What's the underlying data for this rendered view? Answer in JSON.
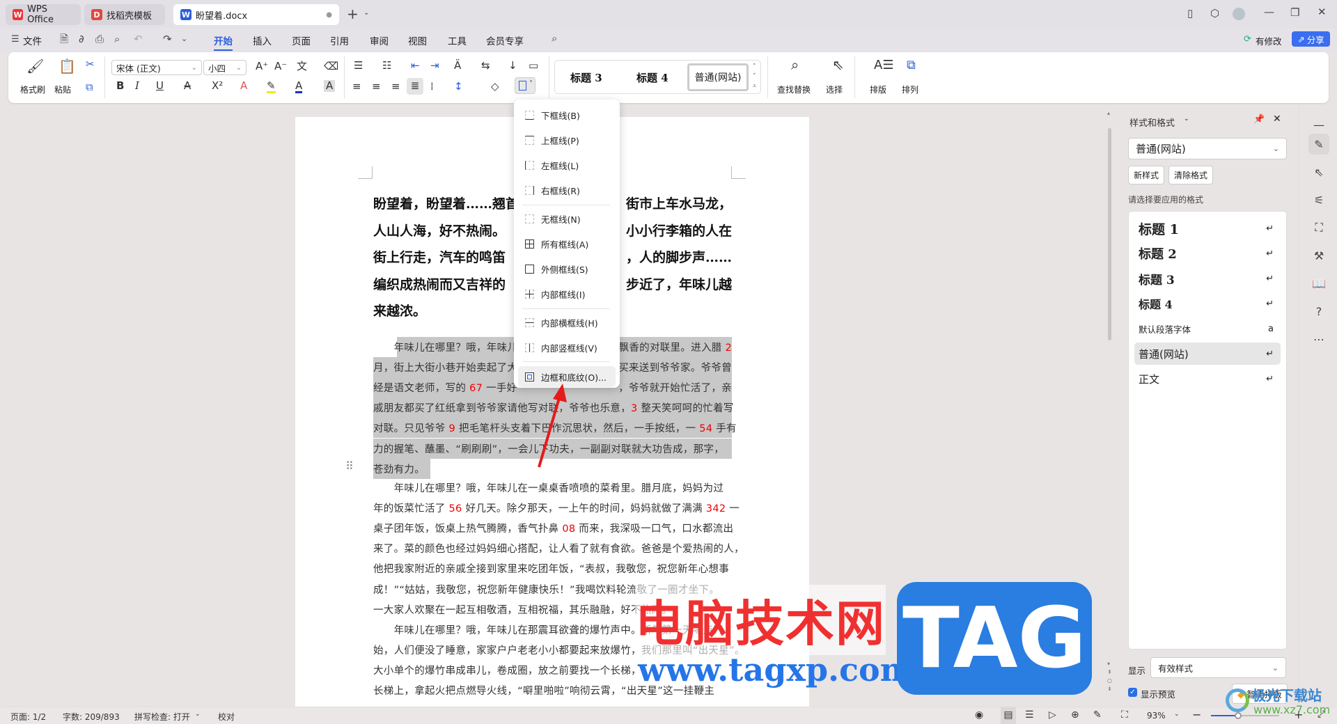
{
  "tabs": [
    {
      "label": "WPS Office",
      "icon": "wps-logo"
    },
    {
      "label": "找稻壳模板",
      "icon": "docer-logo"
    },
    {
      "label": "盼望着.docx",
      "icon": "word-doc-logo"
    }
  ],
  "menu": {
    "file": "文件",
    "tabs": [
      "开始",
      "插入",
      "页面",
      "引用",
      "审阅",
      "视图",
      "工具",
      "会员专享"
    ],
    "modified": "有修改",
    "share": "分享"
  },
  "ribbon": {
    "format_painter": "格式刷",
    "paste": "粘贴",
    "font_name": "宋体 (正文)",
    "font_size": "小四",
    "styles": [
      "标题 3",
      "标题 4",
      "普通(网站)"
    ],
    "find_replace": "查找替换",
    "select": "选择",
    "layout": "排版",
    "arrange": "排列"
  },
  "border_menu": {
    "items": [
      "下框线(B)",
      "上框线(P)",
      "左框线(L)",
      "右框线(R)",
      "无框线(N)",
      "所有框线(A)",
      "外侧框线(S)",
      "内部框线(I)",
      "内部横框线(H)",
      "内部竖框线(V)",
      "边框和底纹(O)..."
    ]
  },
  "document": {
    "heading_lines": [
      [
        "盼望着，盼望着……翘首",
        "。街市上车水马龙，"
      ],
      [
        "人山人海，好不热闹。",
        "小小行李箱的人在"
      ],
      [
        "街上行走，汽车的鸣笛",
        "，人的脚步声……"
      ],
      [
        "编织成热闹而又吉祥的",
        "步近了，年味儿越"
      ],
      [
        "来越浓。",
        ""
      ]
    ],
    "selected_lines": [
      [
        "　　年味儿在哪里？哦，年味儿",
        "飘香的对联里。进入腊 |2|"
      ],
      [
        "月，街上大街小巷开始卖起了大",
        "买来送到爷爷家。爷爷曾"
      ],
      [
        "经是语文老师，写的 |67| 一手好",
        "，爷爷就开始忙活了，亲"
      ],
      [
        "戚朋友都买了红纸拿到爷爷家请他写对联，爷爷也乐意，|3| 整天笑呵呵的忙着写",
        ""
      ],
      [
        "对联。只见爷爷 |9| 把毛笔杆头支着下巴作沉思状，然后，一手按纸，一 |54| 手有",
        ""
      ],
      [
        "力的握笔、蘸墨、“刷刷刷”，一会儿下功夫，一副副对联就大功告成，那字，",
        ""
      ],
      [
        "苍劲有力。",
        ""
      ]
    ],
    "body_lines": [
      "　　年味儿在哪里？哦，年味儿在一桌桌香喷喷的菜肴里。腊月底，妈妈为过",
      "年的饭菜忙活了 |56| 好几天。除夕那天，一上午的时间，妈妈就做了满满 |342| 一",
      "桌子团年饭，饭桌上热气腾腾，香气扑鼻 |08| 而来，我深吸一口气，口水都流出",
      "来了。菜的颜色也经过妈妈细心搭配，让人看了就有食欲。爸爸是个爱热闹的人，",
      "他把我家附近的亲戚全接到家里来吃团年饭，“表叔，我敬您，祝您新年心想事",
      "成！”“姑姑，我敬您，祝您新年健康快乐！”我喝饮料轮流敬了一圈才坐下。",
      "一大家人欢聚在一起互相敬酒，互相祝福，其乐融融，好不热闹。",
      "　　年味儿在哪里？哦，年味儿在那震耳欲聋的爆竹声中。新年第一天零点开",
      "始，人们便没了睡意，家家户户老老小小都要起来放爆竹，我们那里叫“出天星”。",
      "大小单个的爆竹串成串儿，卷成圈，放之前要找一个长梯，",
      "长梯上，拿起火把点燃导火线，“噼里啪啦”响彻云霄，“出天星”这一挂鞭主"
    ]
  },
  "styles_panel": {
    "title": "样式和格式",
    "current": "普通(网站)",
    "new_style": "新样式",
    "clear_format": "清除格式",
    "prompt": "请选择要应用的格式",
    "items": [
      "标题 1",
      "标题 2",
      "标题 3",
      "标题 4",
      "默认段落字体",
      "普通(网站)",
      "正文"
    ],
    "show_label": "显示",
    "show_value": "有效样式",
    "preview_label": "显示预览",
    "smart_layout": "智能排版"
  },
  "status": {
    "page": "页面: 1/2",
    "words": "字数: 209/893",
    "spell": "拼写检查: 打开",
    "proof": "校对",
    "zoom": "93%",
    "zoom_fraction": 0.4
  },
  "watermarks": {
    "site_cn": "电脑技术网",
    "site_url": "www.tagxp.com",
    "tag": "TAG",
    "xz7_name": "极光下载站",
    "xz7_url": "www.xz7.com"
  },
  "colors": {
    "accent": "#2b5fd9",
    "selection": "#c8c8c8",
    "red_numbers": "#e00000"
  }
}
